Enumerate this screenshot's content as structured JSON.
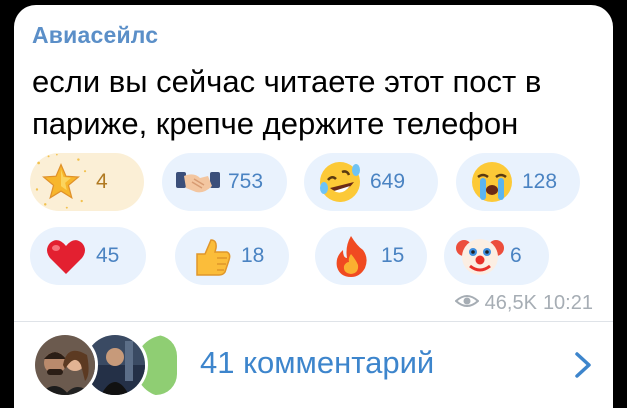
{
  "post": {
    "channel_name": "Авиасейлс",
    "text_line1": "если вы сейчас читаете этот пост в",
    "text_line2": "париже, крепче держите телефон"
  },
  "reactions": [
    {
      "icon": "star-icon",
      "count": "4",
      "chosen": true
    },
    {
      "icon": "handshake-icon",
      "count": "753"
    },
    {
      "icon": "rofl-face-icon",
      "count": "649"
    },
    {
      "icon": "crying-face-icon",
      "count": "128"
    },
    {
      "icon": "heart-icon",
      "count": "45"
    },
    {
      "icon": "thumbs-up-icon",
      "count": "18"
    },
    {
      "icon": "fire-icon",
      "count": "15"
    },
    {
      "icon": "clown-face-icon",
      "count": "6"
    }
  ],
  "meta": {
    "views": "46,5K",
    "time": "10:21",
    "views_icon": "eye-icon"
  },
  "comments": {
    "label": "41 комментарий",
    "chevron_icon": "chevron-right-icon"
  },
  "colors": {
    "accent": "#3d85cc",
    "channel": "#5b8fc8",
    "chip": "#e9f2fd",
    "chosen_chip": "#fbefd6"
  }
}
